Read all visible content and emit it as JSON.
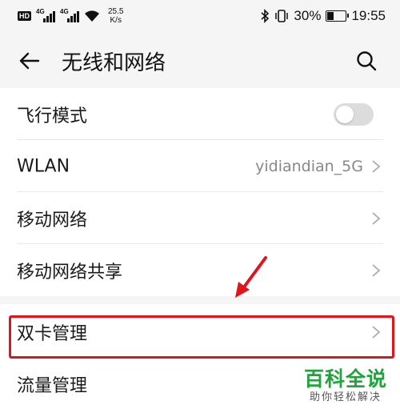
{
  "status_bar": {
    "hd_label": "HD",
    "network_type_1": "4G",
    "network_type_2": "4G",
    "speed_value": "25.5",
    "speed_unit": "K/s",
    "battery_percent": "30%",
    "time": "19:55"
  },
  "header": {
    "title": "无线和网络",
    "back_icon": "arrow-left-icon",
    "search_icon": "search-icon"
  },
  "settings": [
    {
      "label": "飞行模式",
      "type": "toggle",
      "toggle_on": false
    },
    {
      "label": "WLAN",
      "value": "yidiandian_5G",
      "type": "link"
    },
    {
      "label": "移动网络",
      "type": "link"
    },
    {
      "label": "移动网络共享",
      "type": "link"
    },
    {
      "label": "双卡管理",
      "type": "link",
      "highlighted": true
    },
    {
      "label": "流量管理",
      "type": "link"
    }
  ],
  "watermark": {
    "title": "百科全说",
    "subtitle": "助你轻松解决"
  },
  "colors": {
    "highlight": "#e0151b",
    "watermark_green": "#1fa33b",
    "background": "#f5f5f5"
  }
}
